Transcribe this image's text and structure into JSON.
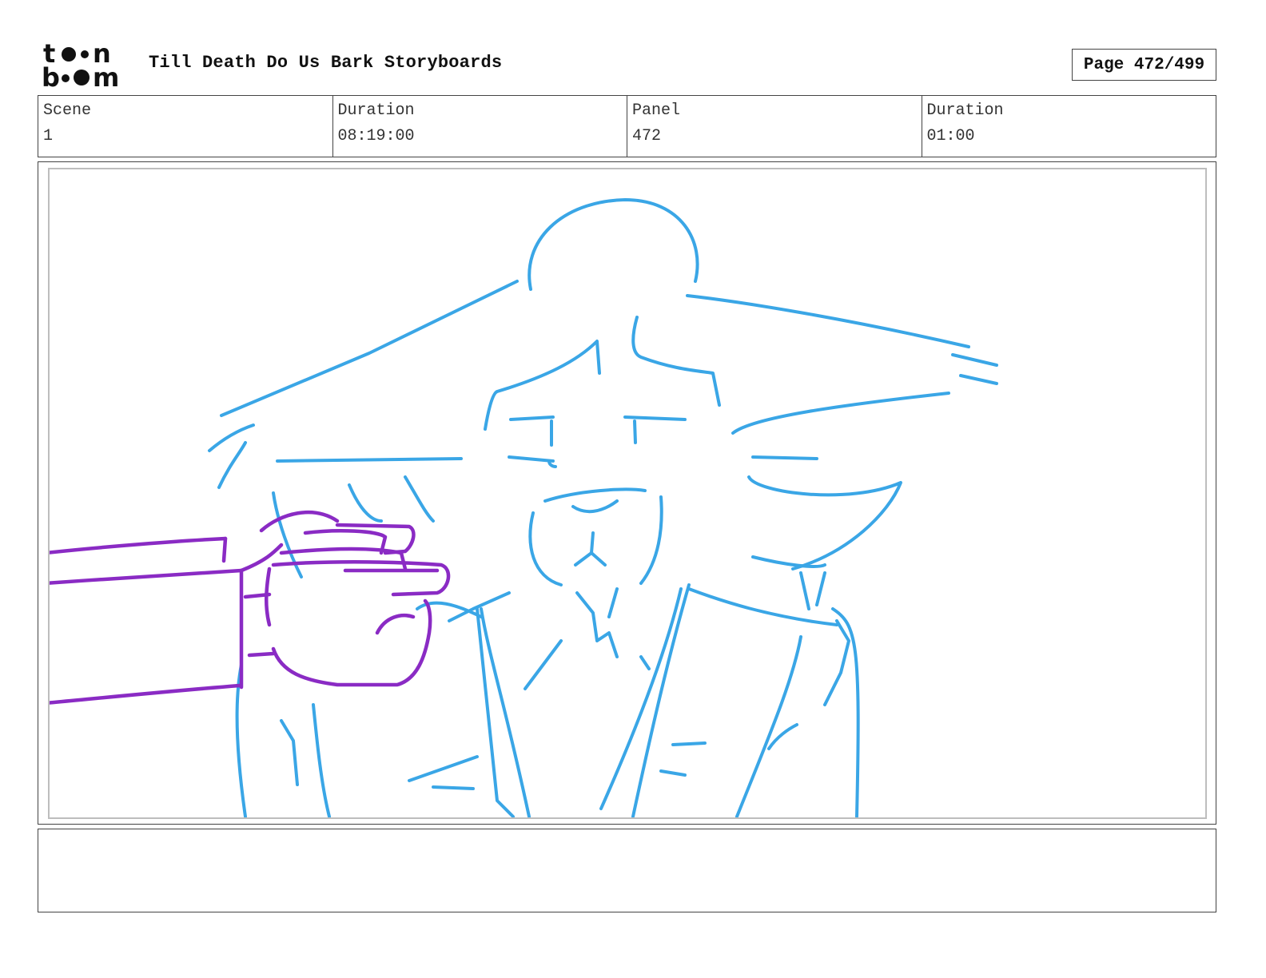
{
  "header": {
    "logo_text": "toon boom",
    "title": "Till Death Do Us Bark Storyboards",
    "page": "Page 472/499"
  },
  "info": [
    {
      "label": "Scene",
      "value": "1"
    },
    {
      "label": "Duration",
      "value": "08:19:00"
    },
    {
      "label": "Panel",
      "value": "472"
    },
    {
      "label": "Duration",
      "value": "01:00"
    }
  ],
  "panel": {
    "image": "storyboard-sketch",
    "colors": {
      "character": "#3aa6e6",
      "hand": "#8a2bc4"
    }
  },
  "notes": {
    "text": ""
  }
}
